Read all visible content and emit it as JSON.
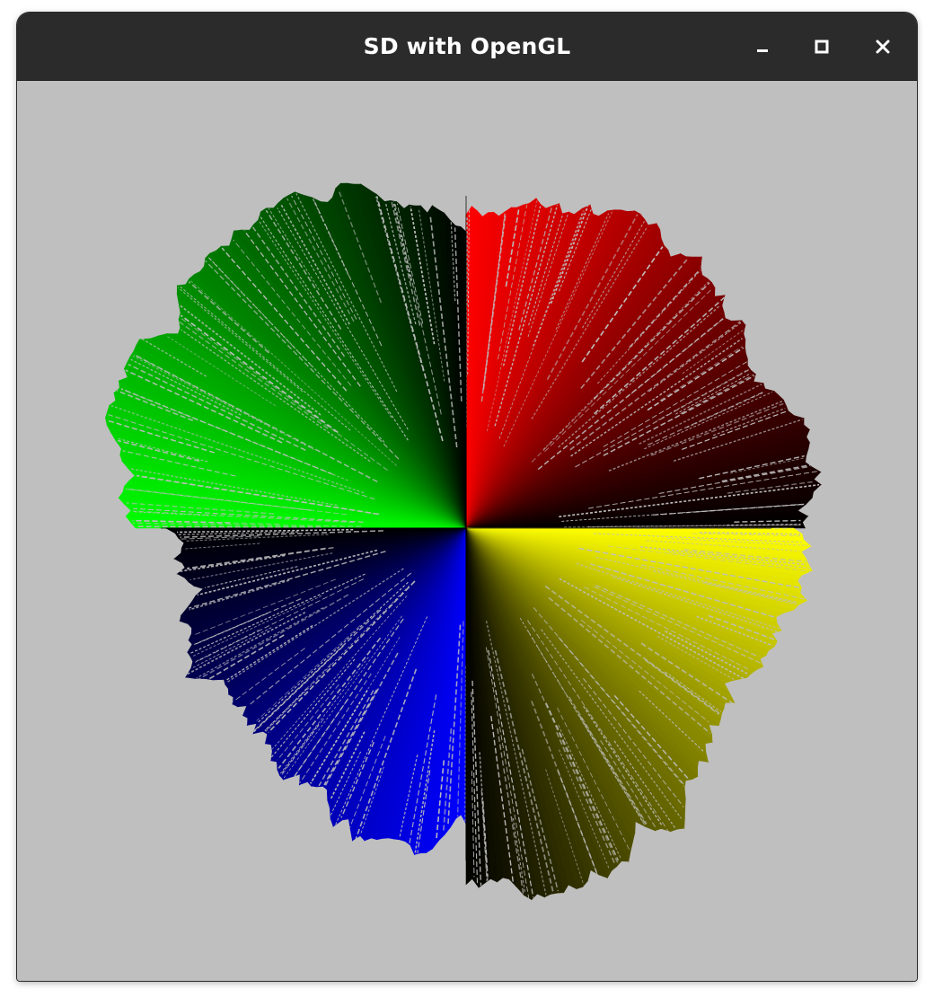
{
  "window": {
    "title": "SD with OpenGL"
  },
  "controls": {
    "minimize_icon": "minimize-icon",
    "maximize_icon": "maximize-icon",
    "close_icon": "close-icon"
  },
  "colors": {
    "titlebar": "#2b2b2b",
    "canvas_background": "#bfbfbf",
    "quadrant_top_right": "#ff0000",
    "quadrant_top_left": "#00ff00",
    "quadrant_bottom_left": "#0000ff",
    "quadrant_bottom_right": "#ffff00",
    "center": "#000000"
  }
}
